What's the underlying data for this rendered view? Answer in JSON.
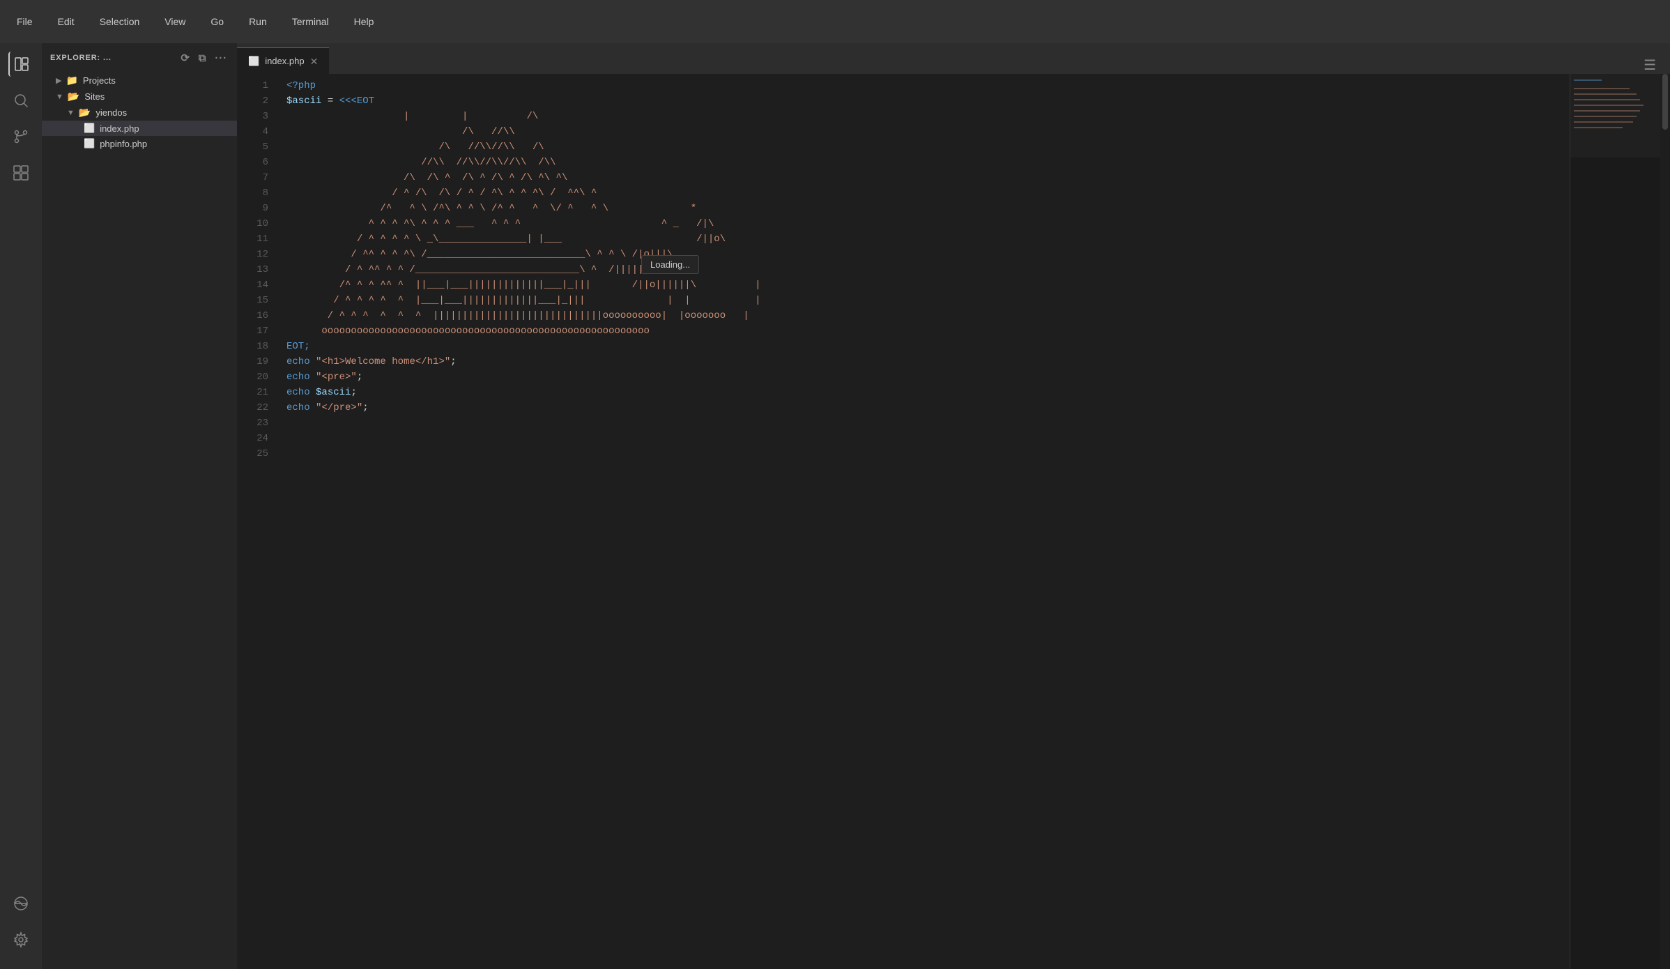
{
  "titlebar": {
    "menus": [
      "File",
      "Edit",
      "Selection",
      "View",
      "Go",
      "Run",
      "Terminal",
      "Help"
    ]
  },
  "sidebar": {
    "header": "EXPLORER: ...",
    "tree": [
      {
        "id": "projects",
        "label": "Projects",
        "type": "folder",
        "indent": 0,
        "collapsed": true
      },
      {
        "id": "sites",
        "label": "Sites",
        "type": "folder",
        "indent": 0,
        "collapsed": false
      },
      {
        "id": "yiendos",
        "label": "yiendos",
        "type": "folder",
        "indent": 1,
        "collapsed": false
      },
      {
        "id": "index.php",
        "label": "index.php",
        "type": "file",
        "indent": 2,
        "selected": true
      },
      {
        "id": "phpinfo.php",
        "label": "phpinfo.php",
        "type": "file",
        "indent": 2,
        "selected": false
      }
    ]
  },
  "tab": {
    "filename": "index.php",
    "icon": "php"
  },
  "code": {
    "lines": [
      {
        "num": 1,
        "content": "<?php",
        "type": "php_open"
      },
      {
        "num": 2,
        "content": "",
        "type": "blank"
      },
      {
        "num": 3,
        "content": "$ascii = <<<EOT",
        "type": "heredoc_open"
      },
      {
        "num": 4,
        "content": "                    |         |          /\\",
        "type": "ascii"
      },
      {
        "num": 5,
        "content": "                              /\\   //\\\\",
        "type": "ascii"
      },
      {
        "num": 6,
        "content": "                          /\\   //\\\\//\\\\   /\\",
        "type": "ascii"
      },
      {
        "num": 7,
        "content": "                       //\\\\  //\\\\//\\\\//\\\\  /\\\\",
        "type": "ascii"
      },
      {
        "num": 8,
        "content": "                    /\\  /\\ ^  /\\ ^ /\\ ^ /\\ ^\\ ^\\",
        "type": "ascii"
      },
      {
        "num": 9,
        "content": "                  / ^ /\\  /\\ / ^ / ^\\ ^ ^ ^\\ /  ^^\\ ^",
        "type": "ascii"
      },
      {
        "num": 10,
        "content": "                /^   ^ \\ /^\\ ^ ^ \\ /^ ^   ^  \\/ ^   ^ \\              *",
        "type": "ascii"
      },
      {
        "num": 11,
        "content": "              ^ ^ ^ ^\\ ^ ^ ^ ___   ^ ^ ^                        ^ _   /|\\",
        "type": "ascii"
      },
      {
        "num": 12,
        "content": "            / ^ ^ ^ ^ \\ _\\_______________| |___                       /||o\\",
        "type": "ascii"
      },
      {
        "num": 13,
        "content": "           / ^^ ^ ^ ^\\ /___________________________\\ ^ ^ \\ /|o|||\\",
        "type": "ascii"
      },
      {
        "num": 14,
        "content": "          / ^ ^^ ^ ^ /____________________________\\ ^  /|||||o|\\",
        "type": "ascii"
      },
      {
        "num": 15,
        "content": "         /^ ^ ^ ^^ ^  ||___|___|||||||||||||___|_|||       /||o||||||\\          |",
        "type": "ascii"
      },
      {
        "num": 16,
        "content": "        / ^ ^ ^ ^  ^  |___|___|||||||||||||___|_|||              |  |           |",
        "type": "ascii"
      },
      {
        "num": 17,
        "content": "       / ^ ^ ^  ^  ^  ^  |||||||||||||||||||||||||||||oooooooooo|  |ooooooo   |",
        "type": "ascii"
      },
      {
        "num": 18,
        "content": "      oooooooooooooooooooooooooooooooooooooooooooooooooooooooo",
        "type": "ascii"
      },
      {
        "num": 19,
        "content": "EOT;",
        "type": "heredoc_close"
      },
      {
        "num": 20,
        "content": "",
        "type": "blank"
      },
      {
        "num": 21,
        "content": "echo \"<h1>Welcome home</h1>\";",
        "type": "echo"
      },
      {
        "num": 22,
        "content": "echo \"<pre>\";",
        "type": "echo"
      },
      {
        "num": 23,
        "content": "echo $ascii;",
        "type": "echo"
      },
      {
        "num": 24,
        "content": "echo \"</pre>\";",
        "type": "echo"
      },
      {
        "num": 25,
        "content": "",
        "type": "blank"
      }
    ]
  },
  "tooltip": {
    "text": "Loading..."
  },
  "activity": {
    "icons": [
      "explorer",
      "search",
      "git",
      "extensions",
      "remote"
    ],
    "bottom": [
      "settings"
    ]
  }
}
